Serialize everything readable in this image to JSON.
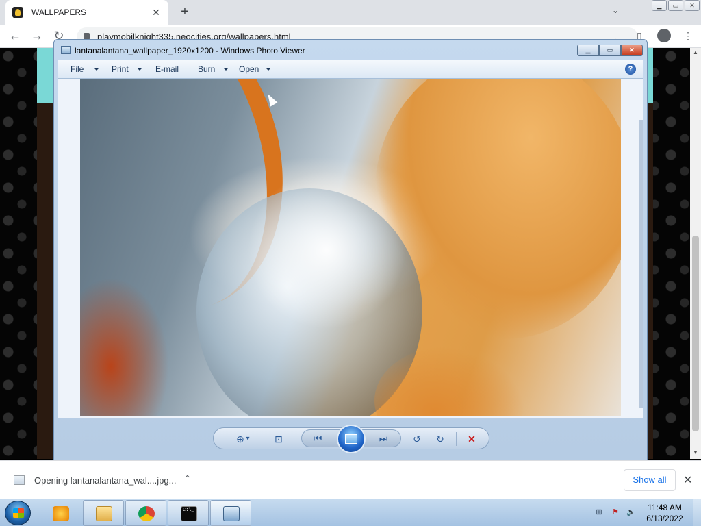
{
  "browser": {
    "tab_title": "WALLPAPERS",
    "tab_close_glyph": "✕",
    "new_tab_glyph": "+",
    "tab_search_glyph": "⌄",
    "url": "playmobilknight335.neocities.org/wallpapers.html",
    "back_glyph": "←",
    "forward_glyph": "→",
    "reload_glyph": "↻",
    "share_glyph": "⇗",
    "star_glyph": "☆",
    "menu_glyph": "⋮",
    "sidepanel_glyph": "▯"
  },
  "photo_viewer": {
    "title": "lantanalantana_wallpaper_1920x1200 - Windows Photo Viewer",
    "window_buttons": {
      "minimize": "▁",
      "maximize": "▭",
      "close": "✕"
    },
    "menu": {
      "file": "File",
      "print": "Print",
      "email": "E-mail",
      "burn": "Burn",
      "open": "Open"
    },
    "help_glyph": "?",
    "controls": {
      "zoom_glyph": "⊕",
      "zoom_dropdown_glyph": "▾",
      "fit_glyph": "⊡",
      "previous_glyph": "⏮",
      "next_glyph": "⏭",
      "rotate_ccw_glyph": "↺",
      "rotate_cw_glyph": "↻",
      "delete_glyph": "✕"
    }
  },
  "download_bar": {
    "item_text": "Opening lantanalantana_wal....jpg...",
    "chevron_glyph": "⌃",
    "show_all": "Show all",
    "close_glyph": "✕"
  },
  "taskbar": {
    "tray": {
      "network_glyph": "⊞",
      "flag_glyph": "⚑",
      "volume_glyph": "🔈"
    },
    "clock_time": "11:48 AM",
    "clock_date": "6/13/2022",
    "cmd_label": "C:\\_"
  },
  "colors": {
    "viewer_frame": "#c5d9ee",
    "viewer_close": "#c6391b",
    "chrome_tabstrip": "#dee1e6",
    "download_link": "#1a73e8",
    "page_accent_teal": "#7ad8d6"
  }
}
